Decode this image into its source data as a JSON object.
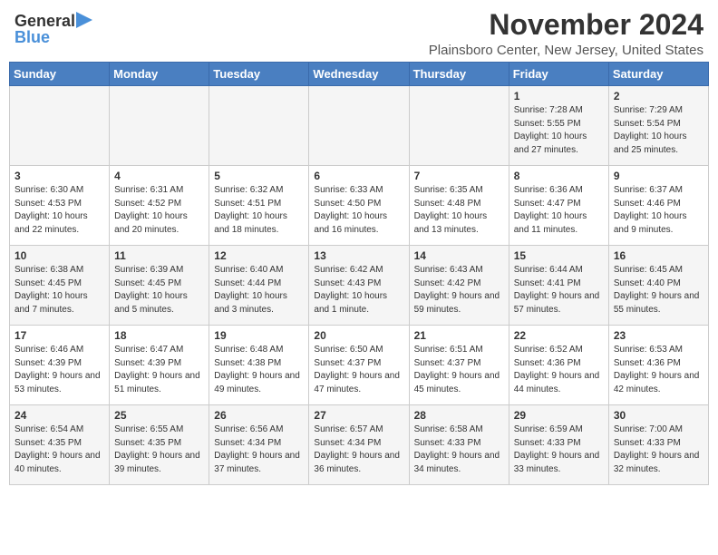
{
  "header": {
    "logo_top": "General",
    "logo_bottom": "Blue",
    "month_title": "November 2024",
    "location": "Plainsboro Center, New Jersey, United States"
  },
  "days_of_week": [
    "Sunday",
    "Monday",
    "Tuesday",
    "Wednesday",
    "Thursday",
    "Friday",
    "Saturday"
  ],
  "weeks": [
    [
      {
        "day": "",
        "sunrise": "",
        "sunset": "",
        "daylight": ""
      },
      {
        "day": "",
        "sunrise": "",
        "sunset": "",
        "daylight": ""
      },
      {
        "day": "",
        "sunrise": "",
        "sunset": "",
        "daylight": ""
      },
      {
        "day": "",
        "sunrise": "",
        "sunset": "",
        "daylight": ""
      },
      {
        "day": "",
        "sunrise": "",
        "sunset": "",
        "daylight": ""
      },
      {
        "day": "1",
        "sunrise": "7:28 AM",
        "sunset": "5:55 PM",
        "daylight": "10 hours and 27 minutes."
      },
      {
        "day": "2",
        "sunrise": "7:29 AM",
        "sunset": "5:54 PM",
        "daylight": "10 hours and 25 minutes."
      }
    ],
    [
      {
        "day": "3",
        "sunrise": "6:30 AM",
        "sunset": "4:53 PM",
        "daylight": "10 hours and 22 minutes."
      },
      {
        "day": "4",
        "sunrise": "6:31 AM",
        "sunset": "4:52 PM",
        "daylight": "10 hours and 20 minutes."
      },
      {
        "day": "5",
        "sunrise": "6:32 AM",
        "sunset": "4:51 PM",
        "daylight": "10 hours and 18 minutes."
      },
      {
        "day": "6",
        "sunrise": "6:33 AM",
        "sunset": "4:50 PM",
        "daylight": "10 hours and 16 minutes."
      },
      {
        "day": "7",
        "sunrise": "6:35 AM",
        "sunset": "4:48 PM",
        "daylight": "10 hours and 13 minutes."
      },
      {
        "day": "8",
        "sunrise": "6:36 AM",
        "sunset": "4:47 PM",
        "daylight": "10 hours and 11 minutes."
      },
      {
        "day": "9",
        "sunrise": "6:37 AM",
        "sunset": "4:46 PM",
        "daylight": "10 hours and 9 minutes."
      }
    ],
    [
      {
        "day": "10",
        "sunrise": "6:38 AM",
        "sunset": "4:45 PM",
        "daylight": "10 hours and 7 minutes."
      },
      {
        "day": "11",
        "sunrise": "6:39 AM",
        "sunset": "4:45 PM",
        "daylight": "10 hours and 5 minutes."
      },
      {
        "day": "12",
        "sunrise": "6:40 AM",
        "sunset": "4:44 PM",
        "daylight": "10 hours and 3 minutes."
      },
      {
        "day": "13",
        "sunrise": "6:42 AM",
        "sunset": "4:43 PM",
        "daylight": "10 hours and 1 minute."
      },
      {
        "day": "14",
        "sunrise": "6:43 AM",
        "sunset": "4:42 PM",
        "daylight": "9 hours and 59 minutes."
      },
      {
        "day": "15",
        "sunrise": "6:44 AM",
        "sunset": "4:41 PM",
        "daylight": "9 hours and 57 minutes."
      },
      {
        "day": "16",
        "sunrise": "6:45 AM",
        "sunset": "4:40 PM",
        "daylight": "9 hours and 55 minutes."
      }
    ],
    [
      {
        "day": "17",
        "sunrise": "6:46 AM",
        "sunset": "4:39 PM",
        "daylight": "9 hours and 53 minutes."
      },
      {
        "day": "18",
        "sunrise": "6:47 AM",
        "sunset": "4:39 PM",
        "daylight": "9 hours and 51 minutes."
      },
      {
        "day": "19",
        "sunrise": "6:48 AM",
        "sunset": "4:38 PM",
        "daylight": "9 hours and 49 minutes."
      },
      {
        "day": "20",
        "sunrise": "6:50 AM",
        "sunset": "4:37 PM",
        "daylight": "9 hours and 47 minutes."
      },
      {
        "day": "21",
        "sunrise": "6:51 AM",
        "sunset": "4:37 PM",
        "daylight": "9 hours and 45 minutes."
      },
      {
        "day": "22",
        "sunrise": "6:52 AM",
        "sunset": "4:36 PM",
        "daylight": "9 hours and 44 minutes."
      },
      {
        "day": "23",
        "sunrise": "6:53 AM",
        "sunset": "4:36 PM",
        "daylight": "9 hours and 42 minutes."
      }
    ],
    [
      {
        "day": "24",
        "sunrise": "6:54 AM",
        "sunset": "4:35 PM",
        "daylight": "9 hours and 40 minutes."
      },
      {
        "day": "25",
        "sunrise": "6:55 AM",
        "sunset": "4:35 PM",
        "daylight": "9 hours and 39 minutes."
      },
      {
        "day": "26",
        "sunrise": "6:56 AM",
        "sunset": "4:34 PM",
        "daylight": "9 hours and 37 minutes."
      },
      {
        "day": "27",
        "sunrise": "6:57 AM",
        "sunset": "4:34 PM",
        "daylight": "9 hours and 36 minutes."
      },
      {
        "day": "28",
        "sunrise": "6:58 AM",
        "sunset": "4:33 PM",
        "daylight": "9 hours and 34 minutes."
      },
      {
        "day": "29",
        "sunrise": "6:59 AM",
        "sunset": "4:33 PM",
        "daylight": "9 hours and 33 minutes."
      },
      {
        "day": "30",
        "sunrise": "7:00 AM",
        "sunset": "4:33 PM",
        "daylight": "9 hours and 32 minutes."
      }
    ]
  ],
  "labels": {
    "sunrise": "Sunrise:",
    "sunset": "Sunset:",
    "daylight": "Daylight:"
  }
}
